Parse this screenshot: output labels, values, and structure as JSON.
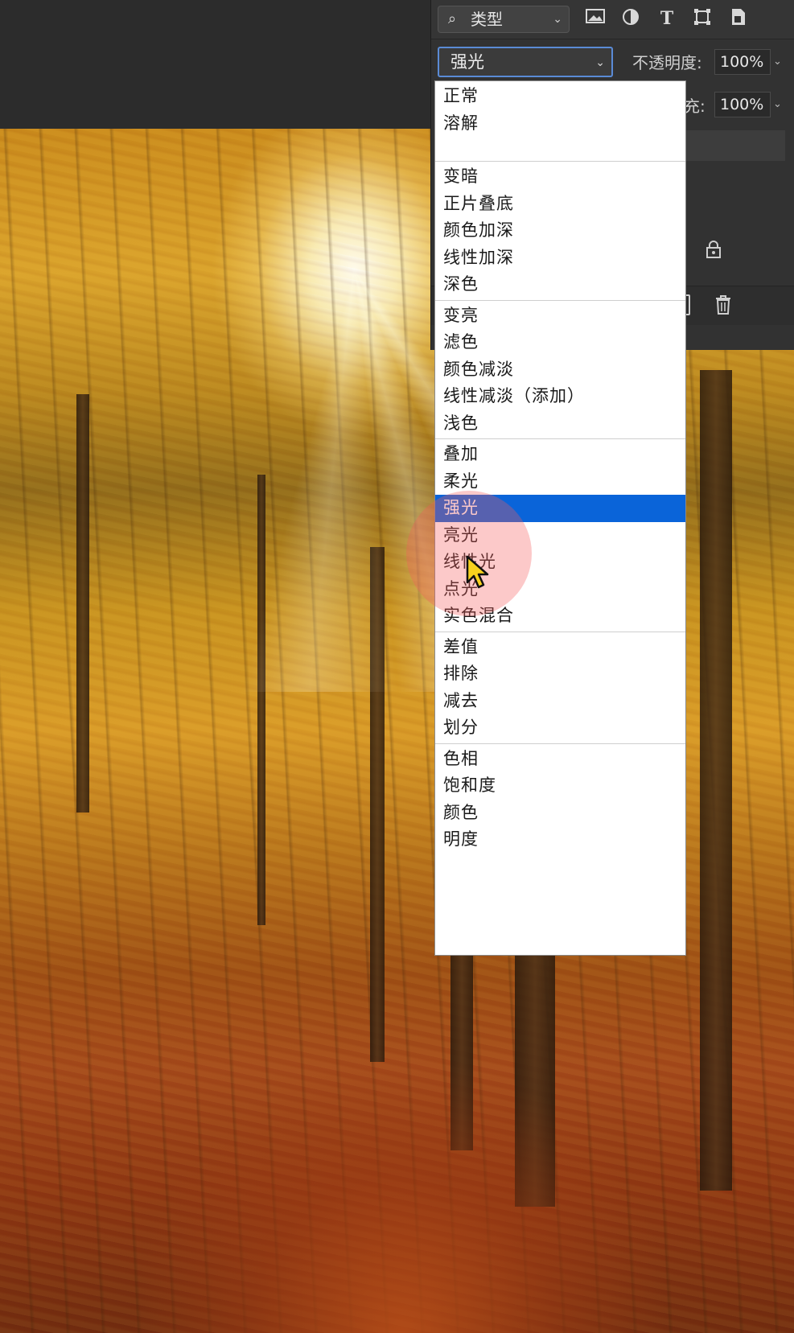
{
  "layers_panel": {
    "filter_kind": {
      "label": "类型",
      "icon": "search-icon"
    },
    "filter_icons": [
      "image-filter-icon",
      "adjustment-filter-icon",
      "type-filter-icon",
      "shape-filter-icon",
      "smart-object-filter-icon"
    ],
    "blend_mode": {
      "selected": "强光"
    },
    "opacity": {
      "label": "不透明度:",
      "value": "100%"
    },
    "fill": {
      "label": "充:",
      "value": "100%"
    }
  },
  "blend_menu": {
    "groups": [
      [
        "正常",
        "溶解"
      ],
      [
        "变暗",
        "正片叠底",
        "颜色加深",
        "线性加深",
        "深色"
      ],
      [
        "变亮",
        "滤色",
        "颜色减淡",
        "线性减淡（添加）",
        "浅色"
      ],
      [
        "叠加",
        "柔光",
        "强光",
        "亮光",
        "线性光",
        "点光",
        "实色混合"
      ],
      [
        "差值",
        "排除",
        "减去",
        "划分"
      ],
      [
        "色相",
        "饱和度",
        "颜色",
        "明度"
      ]
    ],
    "selected": "强光"
  },
  "colors": {
    "selection": "#0a64d9",
    "panel_bg": "#323232",
    "click_highlight": "#f55a5a"
  }
}
